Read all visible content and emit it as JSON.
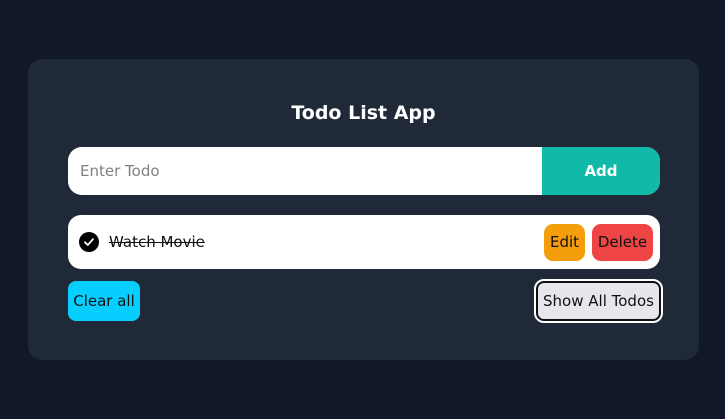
{
  "app": {
    "title": "Todo List App"
  },
  "input": {
    "placeholder": "Enter Todo",
    "value": ""
  },
  "buttons": {
    "add": "Add",
    "clear_all": "Clear all",
    "show_all": "Show All Todos"
  },
  "todos": [
    {
      "text": "Watch Movie",
      "completed": true,
      "edit_label": "Edit",
      "delete_label": "Delete",
      "check_icon": "check-circle-icon"
    }
  ],
  "colors": {
    "page_background": "#111827",
    "card_background": "#1f2937",
    "add_button": "#10b9a8",
    "edit_button": "#f59e0b",
    "delete_button": "#ef4444",
    "clear_button": "#06cfff",
    "show_button": "#e5e7eb"
  }
}
